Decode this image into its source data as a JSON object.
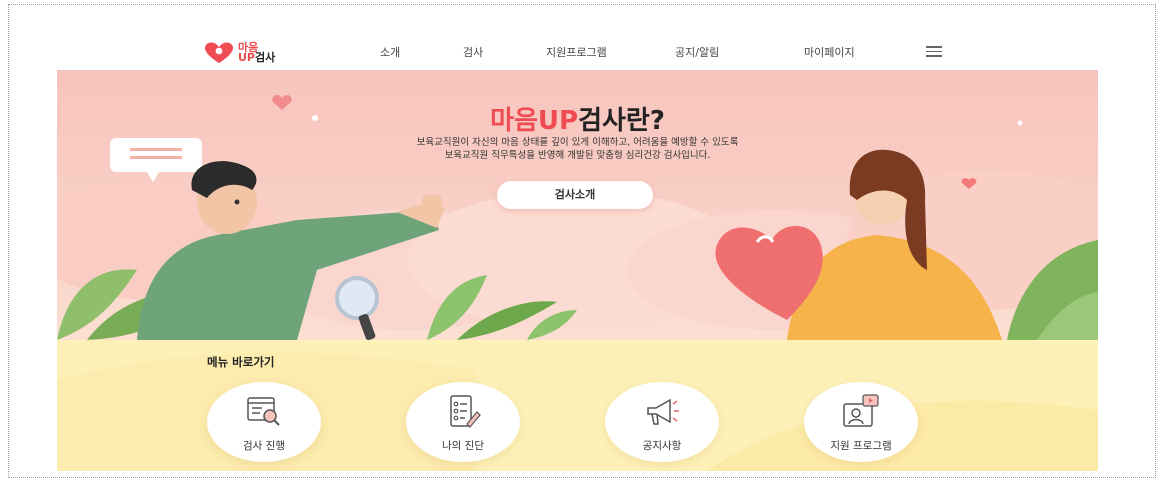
{
  "logo": {
    "line1": "마음",
    "line2_prefix": "UP",
    "line2_suffix": "검사"
  },
  "nav": {
    "items": [
      "소개",
      "검사",
      "지원프로그램",
      "공지/알림",
      "마이페이지"
    ],
    "menu_icon": "hamburger-icon"
  },
  "hero": {
    "title_accent": "마음UP",
    "title_rest": "검사란?",
    "desc_line1": "보육교직원이 자신의 마음 상태를 깊이 있게 이해하고, 어려움을 예방할 수 있도록",
    "desc_line2": "보육교직원 직무특성을 반영해 개발된 맞춤형 심리건강 검사입니다.",
    "button": "검사소개"
  },
  "quick_menu": {
    "title": "메뉴 바로가기",
    "items": [
      {
        "label": "검사 진행",
        "icon": "test-document-search-icon"
      },
      {
        "label": "나의 진단",
        "icon": "checklist-pencil-icon"
      },
      {
        "label": "공지사항",
        "icon": "megaphone-icon"
      },
      {
        "label": "지원 프로그램",
        "icon": "video-profile-icon"
      }
    ]
  },
  "colors": {
    "accent": "#ef4b52",
    "hero_bg": "#f7c4bd",
    "quick_bg": "#fdf1b8"
  }
}
